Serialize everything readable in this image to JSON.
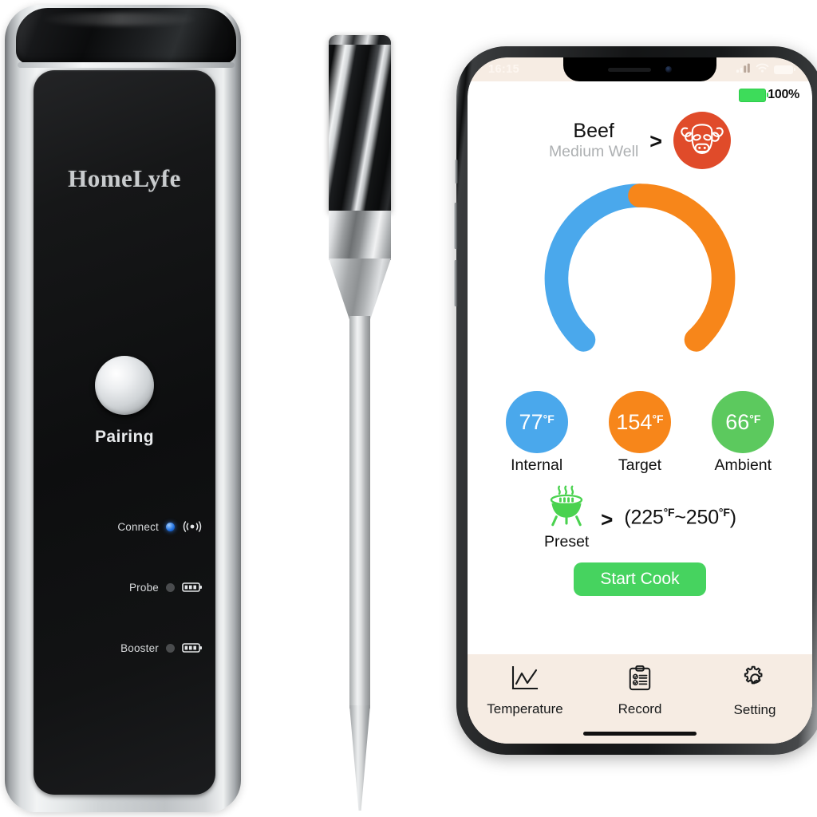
{
  "product": {
    "base_station": {
      "brand": "HomeLyfe",
      "pairing_button_label": "Pairing",
      "indicators": [
        {
          "label": "Connect",
          "led_state": "on",
          "led_color": "#2f7ee8",
          "icon": "wifi-signal-icon"
        },
        {
          "label": "Probe",
          "led_state": "off",
          "led_color": "#4a4c4e",
          "icon": "battery-icon"
        },
        {
          "label": "Booster",
          "led_state": "off",
          "led_color": "#4a4c4e",
          "icon": "battery-icon"
        }
      ]
    },
    "probe": {
      "name": "wireless-meat-probe"
    }
  },
  "phone": {
    "status_bar": {
      "time": "16:15",
      "cellular_icon": "signal-bars-icon",
      "wifi_icon": "wifi-icon",
      "battery_icon": "battery-icon"
    },
    "app": {
      "device_battery": {
        "percent_label": "100%",
        "level": 100,
        "color": "#3ddc5a"
      },
      "food": {
        "name": "Beef",
        "doneness": "Medium Well",
        "chevron": ">",
        "icon": "cow-head-icon",
        "icon_bg": "#e04b2a"
      },
      "gauge": {
        "internal_color": "#4aa8ec",
        "target_color": "#f7861a",
        "track_gap_deg": 70,
        "internal_sweep_deg": 155,
        "target_sweep_deg": 135
      },
      "temperatures": [
        {
          "value": "77",
          "unit": "°F",
          "label": "Internal",
          "color": "#4aa8ec"
        },
        {
          "value": "154",
          "unit": "°F",
          "label": "Target",
          "color": "#f7861a"
        },
        {
          "value": "66",
          "unit": "°F",
          "label": "Ambient",
          "color": "#5cc95e"
        }
      ],
      "preset": {
        "label": "Preset",
        "icon": "grill-icon",
        "icon_color": "#4ad24f",
        "chevron": ">",
        "range_open": "(",
        "range_low": "225",
        "range_unit_low": "°F",
        "range_sep": "~",
        "range_high": "250",
        "range_unit_high": "°F",
        "range_close": ")"
      },
      "start_button": {
        "label": "Start Cook",
        "color": "#46d35f"
      },
      "tabs": [
        {
          "label": "Temperature",
          "icon": "line-chart-icon",
          "active": true
        },
        {
          "label": "Record",
          "icon": "clipboard-icon",
          "active": false
        },
        {
          "label": "Setting",
          "icon": "gear-icon",
          "active": false
        }
      ]
    }
  }
}
